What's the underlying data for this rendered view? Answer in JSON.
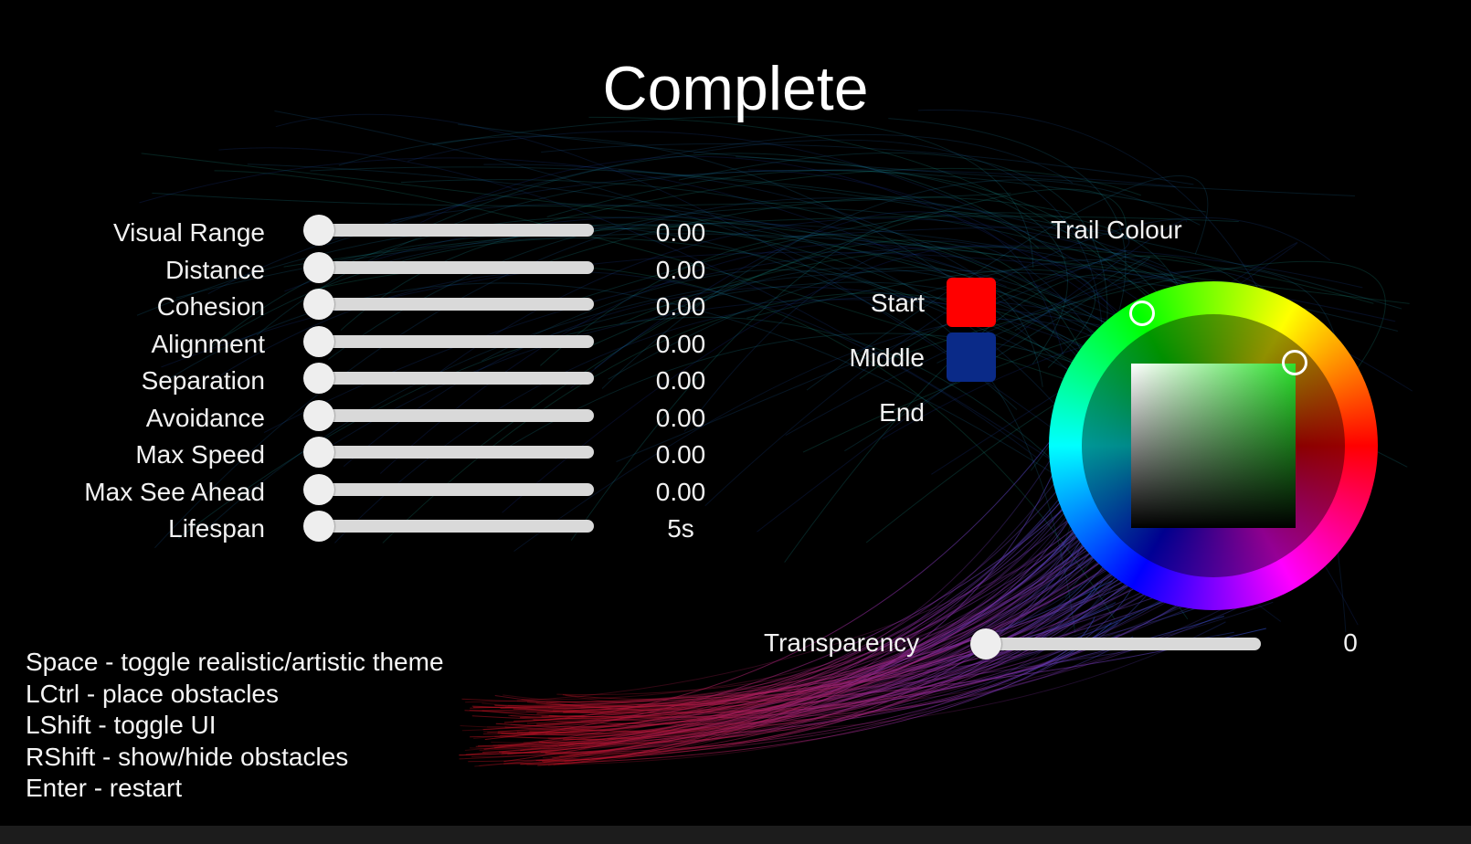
{
  "title": "Complete",
  "parameters": [
    {
      "label": "Visual Range",
      "value": "0.00",
      "level": 0
    },
    {
      "label": "Distance",
      "value": "0.00",
      "level": 0
    },
    {
      "label": "Cohesion",
      "value": "0.00",
      "level": 0
    },
    {
      "label": "Alignment",
      "value": "0.00",
      "level": 0
    },
    {
      "label": "Separation",
      "value": "0.00",
      "level": 0
    },
    {
      "label": "Avoidance",
      "value": "0.00",
      "level": 0
    },
    {
      "label": "Max Speed",
      "value": "0.00",
      "level": 0
    },
    {
      "label": "Max See Ahead",
      "value": "0.00",
      "level": 0
    },
    {
      "label": "Lifespan",
      "value": "5s",
      "level": 0
    }
  ],
  "trail_colour": {
    "heading": "Trail Colour",
    "stops": [
      {
        "label": "Start",
        "color": "#ff0000"
      },
      {
        "label": "Middle",
        "color": "#0a2a88"
      },
      {
        "label": "End",
        "color": null
      }
    ],
    "picker_hue_color": "#2de02d"
  },
  "transparency": {
    "label": "Transparency",
    "value": "0",
    "level": 0
  },
  "hints": [
    "Space - toggle realistic/artistic theme",
    "LCtrl - place obstacles",
    "LShift - toggle UI",
    "RShift - show/hide obstacles",
    "Enter - restart"
  ]
}
